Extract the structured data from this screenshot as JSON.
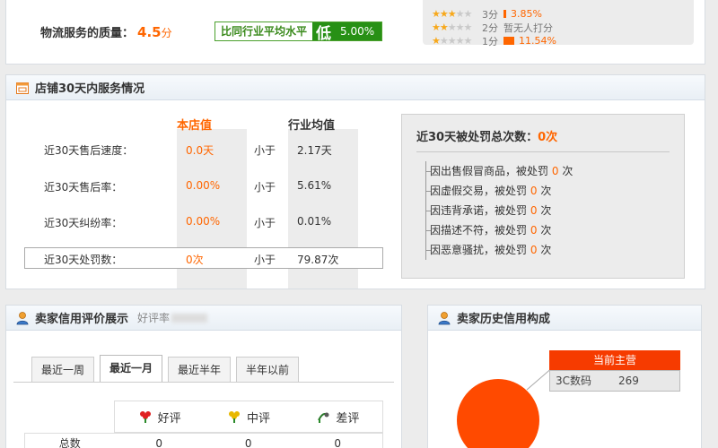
{
  "logistics": {
    "label": "物流服务的质量：",
    "score": "4.5",
    "unit": "分",
    "compare_label": "比同行业平均水平",
    "compare_word": "低",
    "compare_pct": "5.00%"
  },
  "rating_dist": [
    {
      "stars": 3,
      "label": "3分",
      "pct": "3.85%",
      "bar": 0.04
    },
    {
      "stars": 2,
      "label": "2分",
      "pct": "暂无人打分",
      "bar": 0
    },
    {
      "stars": 1,
      "label": "1分",
      "pct": "11.54%",
      "bar": 0.12
    }
  ],
  "service": {
    "title": "店铺30天内服务情况",
    "col_store": "本店值",
    "col_avg": "行业均值",
    "rows": [
      {
        "label": "近30天售后速度：",
        "store": "0.0天",
        "cmp": "小于",
        "avg": "2.17天"
      },
      {
        "label": "近30天售后率：",
        "store": "0.00%",
        "cmp": "小于",
        "avg": "5.61%"
      },
      {
        "label": "近30天纠纷率：",
        "store": "0.00%",
        "cmp": "小于",
        "avg": "0.01%"
      },
      {
        "label": "近30天处罚数：",
        "store": "0次",
        "cmp": "小于",
        "avg": "79.87次"
      }
    ],
    "penalty_title": "近30天被处罚总次数：",
    "penalty_total": "0次",
    "penalties": [
      {
        "text": "因出售假冒商品，被处罚",
        "count": "0",
        "unit": "次"
      },
      {
        "text": "因虚假交易，被处罚",
        "count": "0",
        "unit": "次"
      },
      {
        "text": "因违背承诺，被处罚",
        "count": "0",
        "unit": "次"
      },
      {
        "text": "因描述不符，被处罚",
        "count": "0",
        "unit": "次"
      },
      {
        "text": "因恶意骚扰，被处罚",
        "count": "0",
        "unit": "次"
      }
    ]
  },
  "credit": {
    "title": "卖家信用评价展示",
    "subtitle": "好评率",
    "tabs": [
      "最近一周",
      "最近一月",
      "最近半年",
      "半年以前"
    ],
    "active_tab": 1,
    "headers": [
      "好评",
      "中评",
      "差评"
    ],
    "row_label": "总数",
    "row_values": [
      "0",
      "0",
      "0"
    ]
  },
  "history": {
    "title": "卖家历史信用构成",
    "tip_title": "当前主营",
    "category": "3C数码",
    "count": "269"
  },
  "colors": {
    "accent": "#ff6600",
    "green": "#279015",
    "pie": "#ff4a00"
  }
}
